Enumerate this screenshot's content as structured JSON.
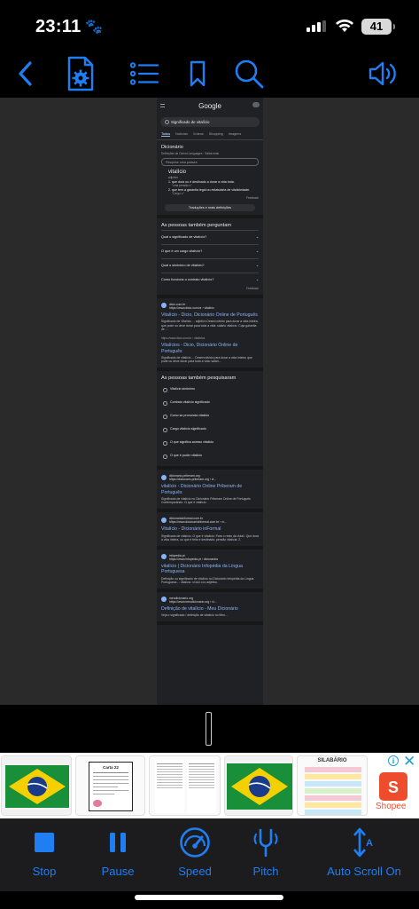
{
  "status_bar": {
    "time": "23:11",
    "battery": "41"
  },
  "toolbar": {
    "icons": [
      "back-icon",
      "document-settings-icon",
      "list-icon",
      "bookmark-icon",
      "search-icon",
      "speaker-icon"
    ],
    "accent": "#1e7ef2"
  },
  "document": {
    "google_logo": "Google",
    "search_query": "Significado de vitalício",
    "tabs": [
      "Todos",
      "Notícias",
      "Vídeos",
      "Shopping",
      "Imagens"
    ],
    "dictionary": {
      "title": "Dicionário",
      "source": "Definições de Oxford Languages · Saiba mais",
      "search_placeholder": "Pesquise uma palavra",
      "word": "vitalício",
      "pos": "adjetivo",
      "def1": "1.  que dura ou é destinado a durar a vida toda.",
      "ex1": "\"uma pensão v.\"",
      "def2": "2.  que tem a garantia legal ou estatutária de vitaliciedade.",
      "ex2": "\"Cargo v.\"",
      "feedback": "Feedback",
      "more": "Traduções e mais definições"
    },
    "people_ask": {
      "title": "As pessoas também perguntam",
      "questions": [
        "Qual o significado de vitalício?",
        "O que é um cargo vitalício?",
        "Qual o sinônimo de vitalício?",
        "Como funciona o contrato vitalício?"
      ],
      "feedback": "Feedback"
    },
    "results_1": [
      {
        "site": "dicio.com.br",
        "url": "https://www.dicio.com.br › vitalicio",
        "title": "Vitalício - Dicio, Dicionário Online de Português",
        "snippet": "Significado de Vitalício ... adjetivo Desenvolvido para durar a vida inteira; que pode ou deve durar para toda a vida: salário vitalício. Cuja garantia de ..."
      },
      {
        "site": "",
        "url": "https://www.dicio.com.br › vitalicios",
        "title": "Vitalícios - Dicio, Dicionário Online de Português",
        "snippet": "Significado de vitalício ... Desenvolvido para durar a vida inteira; que pode ou deve durar para toda a vida: salári..."
      }
    ],
    "related": {
      "title": "As pessoas também pesquisaram",
      "items": [
        "Vitalício sinônimo",
        "Contrato vitalício significado",
        "Como se pronuncia vitalício",
        "Cargo vitalício significado",
        "O que significa acesso vitalício",
        "O que é poder vitalício"
      ]
    },
    "results_2": [
      {
        "site": "dicionario.priberam.org",
        "url": "https://dicionario.priberam.org › vi...",
        "title": "vitalício - Dicionário Online Priberam de Português",
        "snippet": "Significado de vitalício no Dicionário Priberam Online de Português Contemporâneo. O que é vitalício."
      },
      {
        "site": "dicionarioinformal.com.br",
        "url": "https://www.dicionarioinformal.com.br › vi...",
        "title": "Vitalício - Dicionário inFormal",
        "snippet": "Significado de vitalício. O que é vitalício: Para o resto da vida1. Que dura a vida inteira, ou que é feito e destinado; pensão vitalícia. 2."
      },
      {
        "site": "infopedia.pt",
        "url": "https://www.infopedia.pt › dicionarios",
        "title": "vitalício | Dicionário Infopédia da Língua Portuguesa",
        "snippet": "Definição ou significado de vitalício no Dicionário Infopédia da Língua Portuguesa ... vitalício. vi.ta.lí.ci.o adjetivo."
      },
      {
        "site": "meudicionario.org",
        "url": "https://www.meudicionario.org › vi...",
        "title": "Definição de vitalício - Meu Dicionário",
        "snippet": "Veja o significado / definição de vitalício no Meu..."
      }
    ]
  },
  "ad": {
    "brand": "Shopee",
    "close": "✕",
    "info": "i",
    "thumb_label_2": "Carta 22",
    "thumb_label_5": "SILABÁRIO"
  },
  "controls": {
    "stop": "Stop",
    "pause": "Pause",
    "speed": "Speed",
    "pitch": "Pitch",
    "auto_scroll": "Auto Scroll On"
  }
}
